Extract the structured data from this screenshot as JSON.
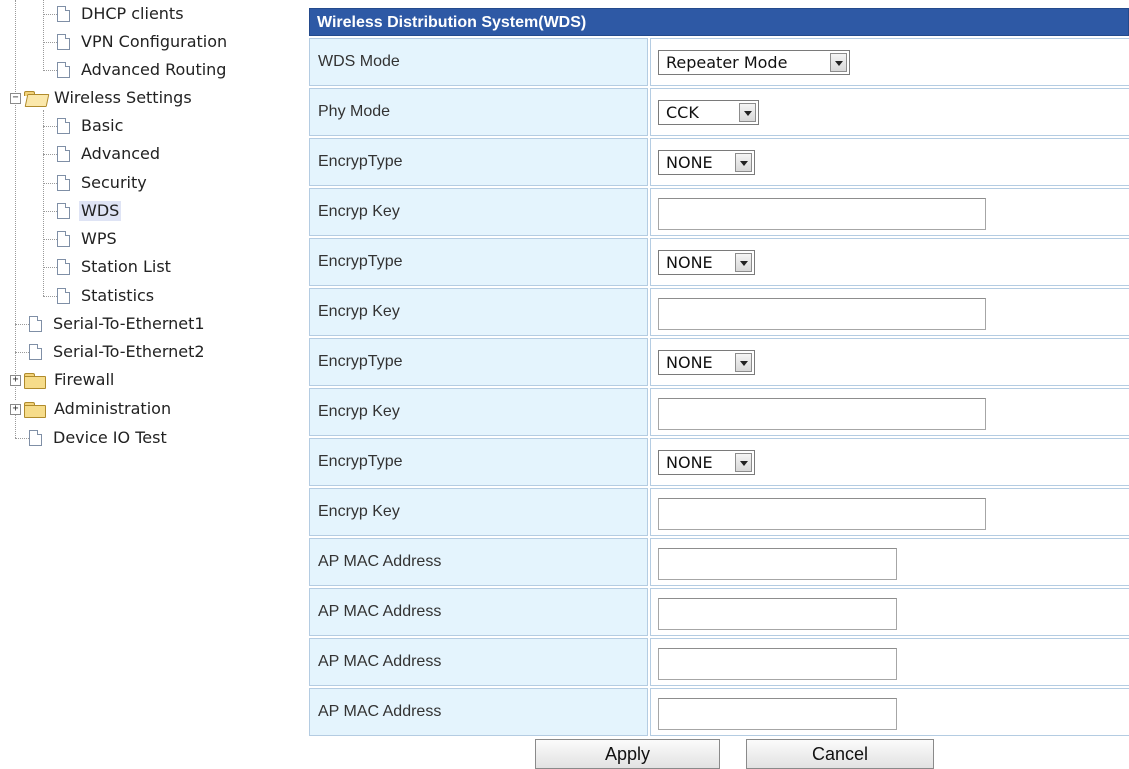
{
  "tree": {
    "items": [
      {
        "label": "DHCP clients"
      },
      {
        "label": "VPN Configuration"
      },
      {
        "label": "Advanced Routing"
      },
      {
        "label": "Wireless Settings"
      },
      {
        "label": "Basic"
      },
      {
        "label": "Advanced"
      },
      {
        "label": "Security"
      },
      {
        "label": "WDS"
      },
      {
        "label": "WPS"
      },
      {
        "label": "Station List"
      },
      {
        "label": "Statistics"
      },
      {
        "label": "Serial-To-Ethernet1"
      },
      {
        "label": "Serial-To-Ethernet2"
      },
      {
        "label": "Firewall"
      },
      {
        "label": "Administration"
      },
      {
        "label": "Device IO Test"
      }
    ],
    "selected": "WDS",
    "expand_open_symbol": "−",
    "expand_closed_symbol": "+",
    "selection_color": "#dfe4f5"
  },
  "wds": {
    "title": "Wireless Distribution System(WDS)",
    "header_color": "#2e59a5",
    "label_bg_color": "#e4f4fd",
    "rows": [
      {
        "label": "WDS Mode",
        "value": "Repeater Mode"
      },
      {
        "label": "Phy Mode",
        "value": "CCK"
      },
      {
        "label": "EncrypType",
        "value": "NONE"
      },
      {
        "label": "Encryp Key",
        "value": ""
      },
      {
        "label": "EncrypType",
        "value": "NONE"
      },
      {
        "label": "Encryp Key",
        "value": ""
      },
      {
        "label": "EncrypType",
        "value": "NONE"
      },
      {
        "label": "Encryp Key",
        "value": ""
      },
      {
        "label": "EncrypType",
        "value": "NONE"
      },
      {
        "label": "Encryp Key",
        "value": ""
      },
      {
        "label": "AP MAC Address",
        "value": ""
      },
      {
        "label": "AP MAC Address",
        "value": ""
      },
      {
        "label": "AP MAC Address",
        "value": ""
      },
      {
        "label": "AP MAC Address",
        "value": ""
      }
    ]
  },
  "buttons": {
    "apply_label": "Apply",
    "cancel_label": "Cancel"
  }
}
